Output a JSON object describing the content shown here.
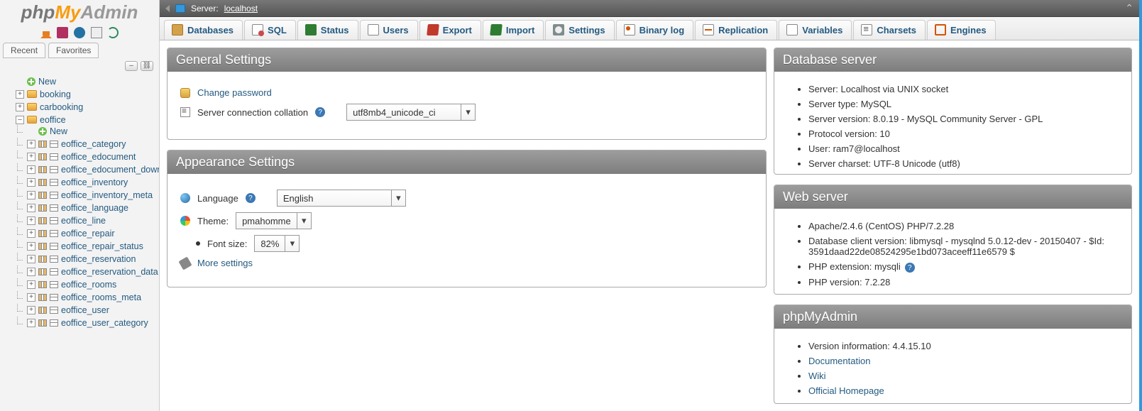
{
  "logo": {
    "php": "php",
    "my": "My",
    "admin": "Admin"
  },
  "sidebar": {
    "tabs": {
      "recent": "Recent",
      "favorites": "Favorites"
    },
    "util": {
      "collapse": "–",
      "link": "⛓"
    },
    "new": "New",
    "dbs": [
      {
        "name": "booking",
        "expanded": false
      },
      {
        "name": "carbooking",
        "expanded": false
      },
      {
        "name": "eoffice",
        "expanded": true,
        "new": "New",
        "tables": [
          "eoffice_category",
          "eoffice_edocument",
          "eoffice_edocument_download",
          "eoffice_inventory",
          "eoffice_inventory_meta",
          "eoffice_language",
          "eoffice_line",
          "eoffice_repair",
          "eoffice_repair_status",
          "eoffice_reservation",
          "eoffice_reservation_data",
          "eoffice_rooms",
          "eoffice_rooms_meta",
          "eoffice_user",
          "eoffice_user_category"
        ]
      }
    ]
  },
  "breadcrumb": {
    "server_label": "Server:",
    "server_value": "localhost"
  },
  "tabs": {
    "databases": "Databases",
    "sql": "SQL",
    "status": "Status",
    "users": "Users",
    "export": "Export",
    "import": "Import",
    "settings": "Settings",
    "binlog": "Binary log",
    "replication": "Replication",
    "variables": "Variables",
    "charsets": "Charsets",
    "engines": "Engines"
  },
  "general": {
    "title": "General Settings",
    "change_password": "Change password",
    "collation_label": "Server connection collation",
    "collation_value": "utf8mb4_unicode_ci"
  },
  "appearance": {
    "title": "Appearance Settings",
    "language_label": "Language",
    "language_value": "English",
    "theme_label": "Theme:",
    "theme_value": "pmahomme",
    "font_label": "Font size:",
    "font_value": "82%",
    "more": "More settings"
  },
  "dbserver": {
    "title": "Database server",
    "items": [
      "Server: Localhost via UNIX socket",
      "Server type: MySQL",
      "Server version: 8.0.19 - MySQL Community Server - GPL",
      "Protocol version: 10",
      "User: ram7@localhost",
      "Server charset: UTF-8 Unicode (utf8)"
    ]
  },
  "webserver": {
    "title": "Web server",
    "items": [
      "Apache/2.4.6 (CentOS) PHP/7.2.28",
      "Database client version: libmysql - mysqlnd 5.0.12-dev - 20150407 - $Id: 3591daad22de08524295e1bd073aceeff11e6579 $",
      "PHP extension: mysqli",
      "PHP version: 7.2.28"
    ]
  },
  "pma": {
    "title": "phpMyAdmin",
    "items": [
      {
        "text": "Version information: 4.4.15.10",
        "link": false
      },
      {
        "text": "Documentation",
        "link": true
      },
      {
        "text": "Wiki",
        "link": true
      },
      {
        "text": "Official Homepage",
        "link": true
      }
    ]
  }
}
